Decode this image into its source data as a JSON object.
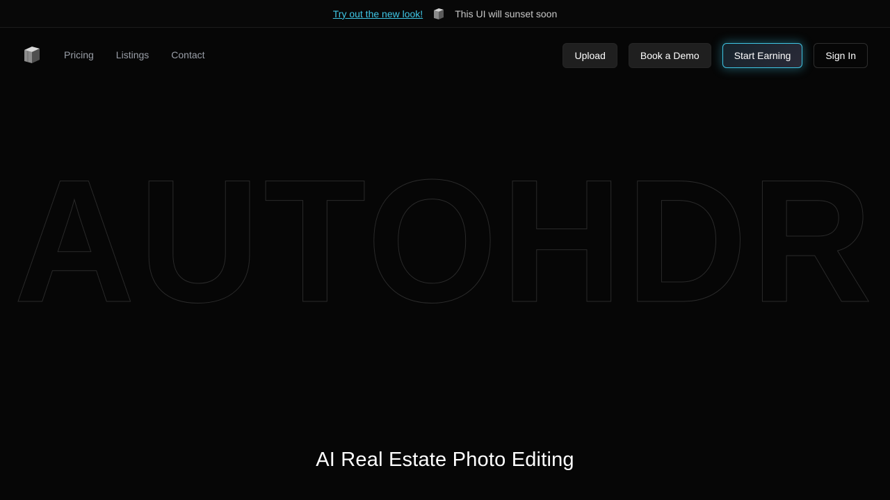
{
  "announcement": {
    "link_label": "Try out the new look!",
    "logo_icon": "cube-logo-icon",
    "text": "This UI will sunset soon"
  },
  "nav": {
    "logo_icon": "cube-logo-icon",
    "links": [
      {
        "label": "Pricing"
      },
      {
        "label": "Listings"
      },
      {
        "label": "Contact"
      }
    ],
    "actions": {
      "upload": "Upload",
      "book_demo": "Book a Demo",
      "start_earning": "Start Earning",
      "sign_in": "Sign In"
    }
  },
  "hero": {
    "outline_text": "AUTOHDR",
    "tagline": "AI Real Estate Photo Editing"
  },
  "colors": {
    "background": "#060606",
    "accent": "#3fc7e6",
    "nav_link": "#9a9fa8",
    "outline_stroke": "#2b2b2b"
  }
}
